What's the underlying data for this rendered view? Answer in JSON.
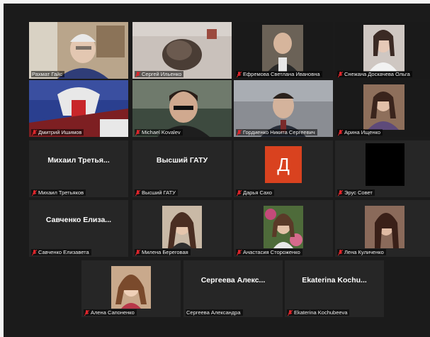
{
  "meeting": {
    "accent_active": "#d7e04a",
    "mute_color": "#e0262c",
    "participants": [
      {
        "name": "Рахмат Гайс",
        "kind": "video"
      },
      {
        "name": "Сергей Ильенко",
        "kind": "video"
      },
      {
        "name": "Ефремова Светлана Ивановна",
        "kind": "video"
      },
      {
        "name": "Снежана Доскачева Ольга",
        "kind": "video"
      },
      {
        "name": "Дмитрий Ишимов",
        "kind": "video"
      },
      {
        "name": "Michael Kovalev",
        "kind": "video"
      },
      {
        "name": "Гордиенко Никита Сергеевич",
        "kind": "video"
      },
      {
        "name": "Арина Ищенко",
        "kind": "video"
      },
      {
        "name": "Михаил Третьяков",
        "kind": "placeholder",
        "display": "Михаил Третья..."
      },
      {
        "name": "Высший ГАТУ",
        "kind": "placeholder",
        "display": "Высший ГАТУ"
      },
      {
        "name": "Дарья Сахо",
        "kind": "avatar",
        "initial": "Д",
        "avatar_color": "#d9421f"
      },
      {
        "name": "Эрус Совет",
        "kind": "dark"
      },
      {
        "name": "Савченко Елизавета",
        "kind": "placeholder",
        "display": "Савченко Елиза..."
      },
      {
        "name": "Милена Береговая",
        "kind": "photo"
      },
      {
        "name": "Анастасия Стороженко",
        "kind": "photo"
      },
      {
        "name": "Лена Куличенко",
        "kind": "photo"
      },
      {
        "name": "Алена Сапоненко",
        "kind": "photo"
      },
      {
        "name": "Сергеева Александра",
        "kind": "placeholder",
        "display": "Сергеева Алекс..."
      },
      {
        "name": "Ekaterina Kochubeeva",
        "kind": "placeholder",
        "display": "Ekaterina Kochu..."
      }
    ]
  }
}
